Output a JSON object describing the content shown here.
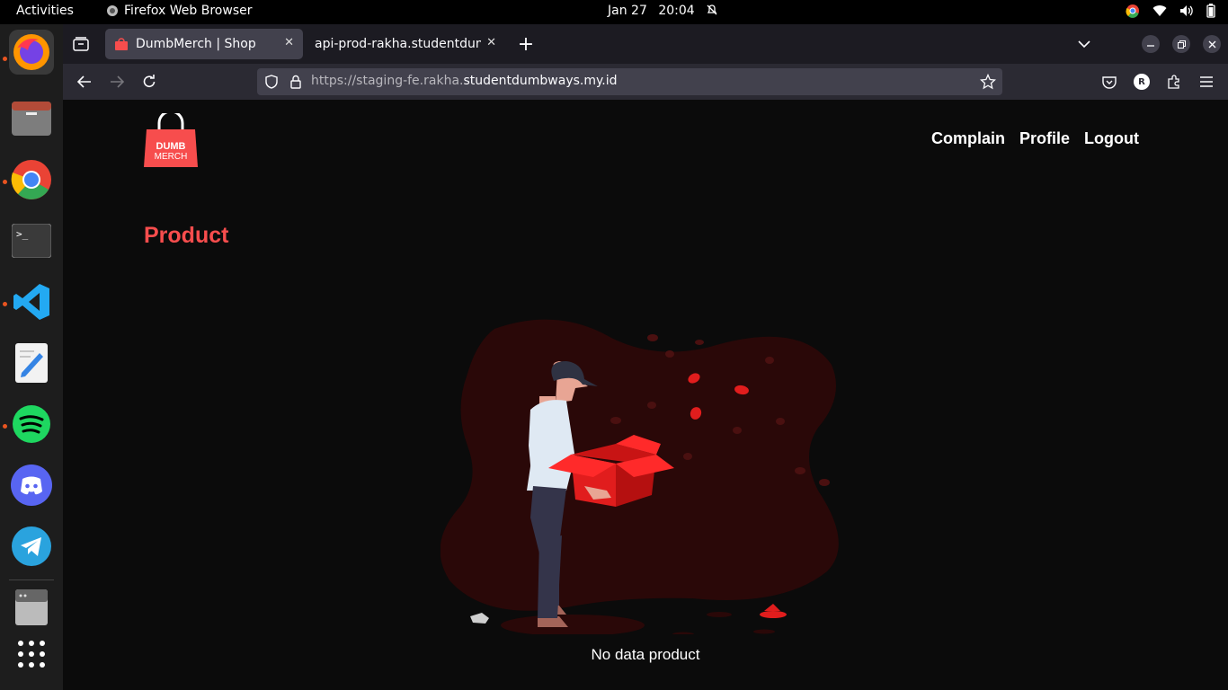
{
  "topbar": {
    "activities": "Activities",
    "app_name": "Firefox Web Browser",
    "date": "Jan 27",
    "time": "20:04"
  },
  "dock": {
    "items": [
      "firefox-icon",
      "files-icon",
      "chrome-icon",
      "terminal-icon",
      "vscode-icon",
      "text-editor-icon",
      "spotify-icon",
      "discord-icon",
      "telegram-icon",
      "drive-icon",
      "apps-grid-icon"
    ]
  },
  "browser": {
    "tabs": [
      {
        "label": "DumbMerch | Shop",
        "active": true
      },
      {
        "label": "api-prod-rakha.studentdumb",
        "active": false
      }
    ],
    "url_prefix": "https://staging-fe.rakha.",
    "url_domain": "studentdumbways.my.id",
    "profile_initial": "R"
  },
  "page": {
    "logo_line1": "DUMB",
    "logo_line2": "MERCH",
    "nav": {
      "complain": "Complain",
      "profile": "Profile",
      "logout": "Logout"
    },
    "title": "Product",
    "empty_message": "No data product"
  },
  "colors": {
    "accent": "#f74d4d",
    "background": "#0b0b0b",
    "blob": "#2a0808"
  }
}
